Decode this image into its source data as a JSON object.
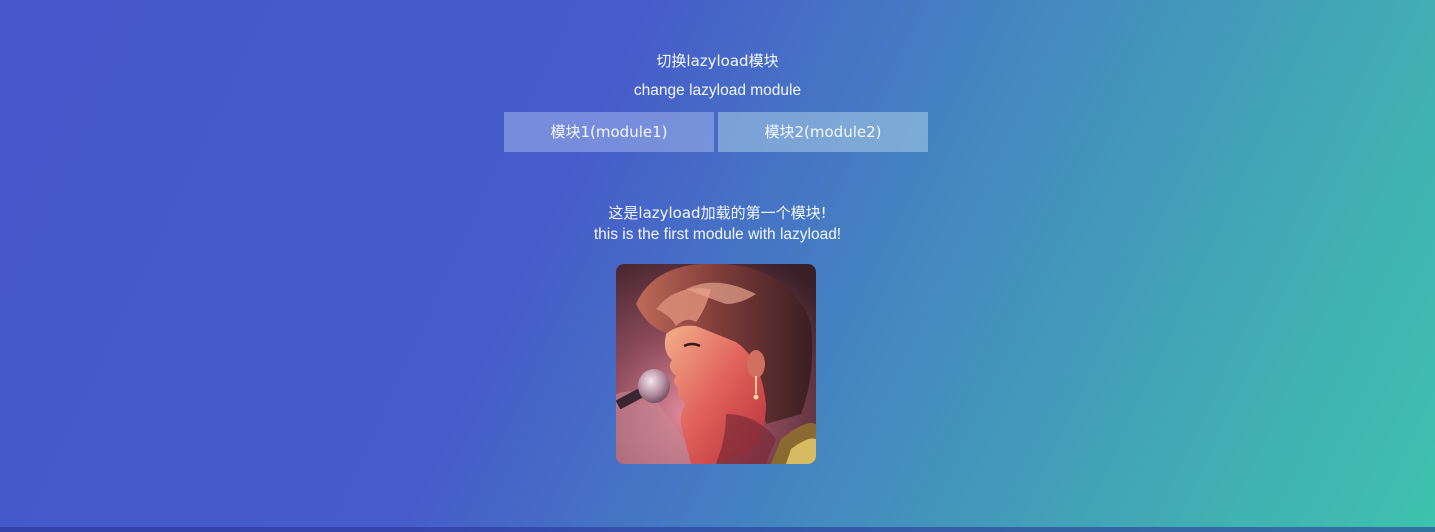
{
  "header": {
    "title_cn": "切换lazyload模块",
    "title_en": "change lazyload module"
  },
  "buttons": [
    {
      "label": "模块1(module1)"
    },
    {
      "label": "模块2(module2)"
    }
  ],
  "module": {
    "text_cn": "这是lazyload加载的第一个模块!",
    "text_en": "this is the first module with lazyload!"
  },
  "image": {
    "alt": ""
  },
  "colors": {
    "gradient_start": "#4658cb",
    "gradient_end": "#3ec2ae",
    "button1_bg": "rgba(160,180,235,0.55)",
    "button2_bg": "rgba(170,205,230,0.55)"
  }
}
